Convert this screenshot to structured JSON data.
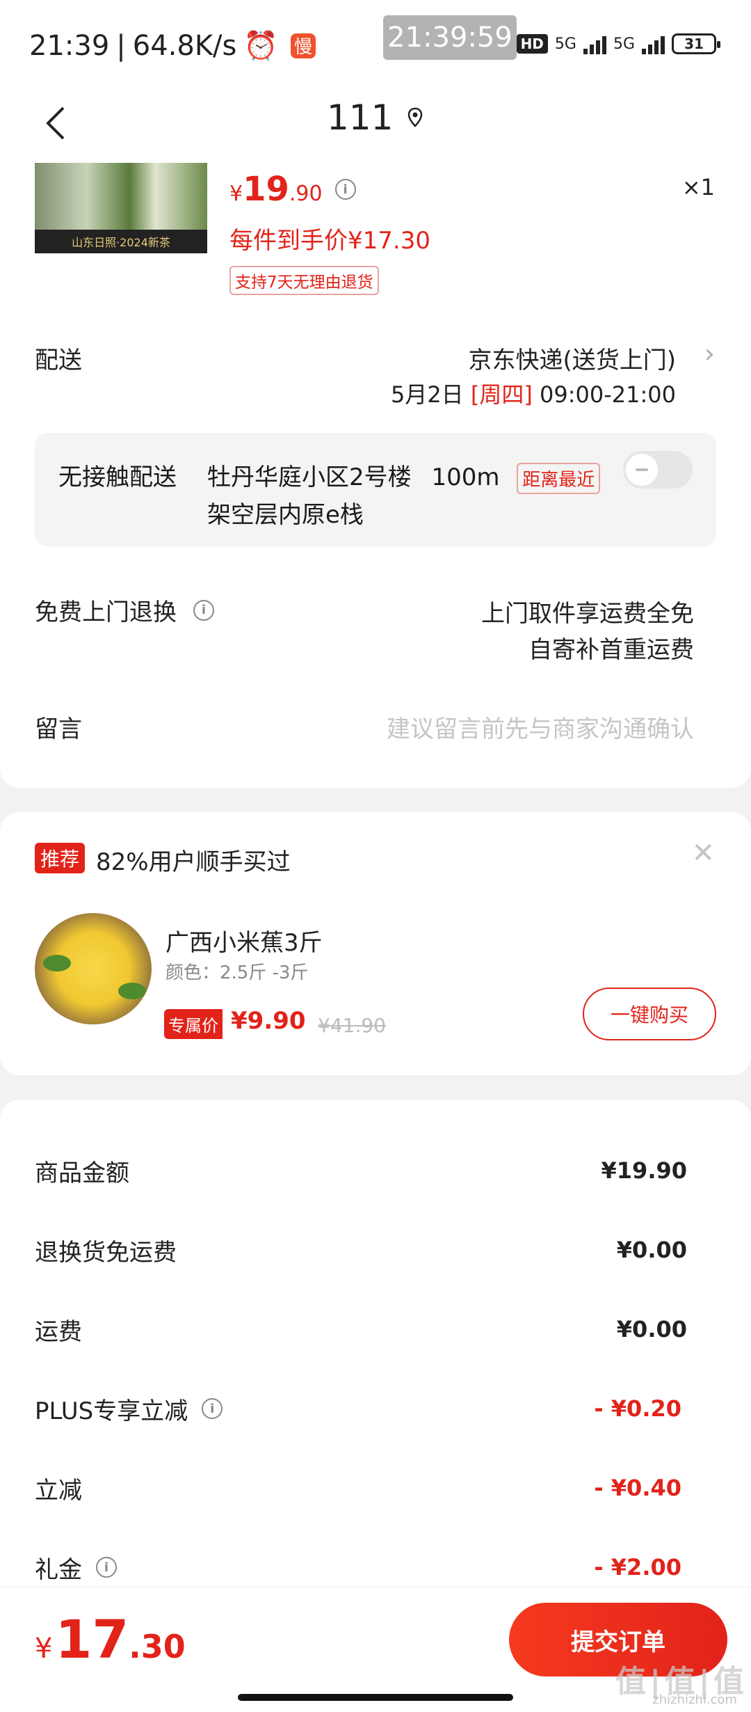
{
  "status_bar": {
    "time": "21:39",
    "network_speed": "64.8K/s",
    "slow_badge": "慢",
    "clock_overlay": "21:39:59",
    "hd": "HD",
    "network1": "5G",
    "network2": "5G",
    "battery": "31"
  },
  "nav": {
    "title": "111",
    "back_icon": "chevron-left-icon",
    "location_icon": "location-pin-icon"
  },
  "product": {
    "thumb_banner": "山东日照·2024新茶",
    "price_yen": "¥",
    "price_int": "19",
    "price_dec": ".90",
    "quantity": "×1",
    "net_price": "每件到手价¥17.30",
    "return_tag": "支持7天无理由退货"
  },
  "delivery": {
    "label": "配送",
    "method": "京东快递(送货上门)",
    "date": "5月2日",
    "weekday": "[周四]",
    "time_slot": "09:00-21:00"
  },
  "contactless": {
    "label": "无接触配送",
    "location_line1": "牡丹华庭小区2号楼",
    "distance": "100m",
    "near_tag": "距离最近",
    "location_line2": "架空层内原e栈",
    "toggle_on": false
  },
  "free_return": {
    "label": "免费上门退换",
    "line1": "上门取件享运费全免",
    "line2": "自寄补首重运费"
  },
  "message": {
    "label": "留言",
    "placeholder": "建议留言前先与商家沟通确认"
  },
  "recommend": {
    "tag": "推荐",
    "title": "82%用户顺手买过",
    "item_name": "广西小米蕉3斤",
    "item_spec": "颜色：2.5斤 -3斤",
    "vip_tag": "专属价",
    "price": "¥9.90",
    "original_price": "¥41.90",
    "buy_button": "一键购买"
  },
  "fees": [
    {
      "label": "商品金额",
      "value": "¥19.90",
      "info": false,
      "red": false
    },
    {
      "label": "退换货免运费",
      "value": "¥0.00",
      "info": false,
      "red": false
    },
    {
      "label": "运费",
      "value": "¥0.00",
      "info": false,
      "red": false
    },
    {
      "label": "PLUS专享立减",
      "value": "- ¥0.20",
      "info": true,
      "red": true
    },
    {
      "label": "立减",
      "value": "- ¥0.40",
      "info": false,
      "red": true
    },
    {
      "label": "礼金",
      "value": "- ¥2.00",
      "info": true,
      "red": true
    }
  ],
  "footer": {
    "total_yen": "¥",
    "total_int": "17",
    "total_dec": ".30",
    "submit": "提交订单"
  },
  "watermark": {
    "main": "值|值|值",
    "sub": "zhizhizhi.com"
  },
  "colors": {
    "accent": "#e2231a",
    "background": "#f2f2f2"
  }
}
